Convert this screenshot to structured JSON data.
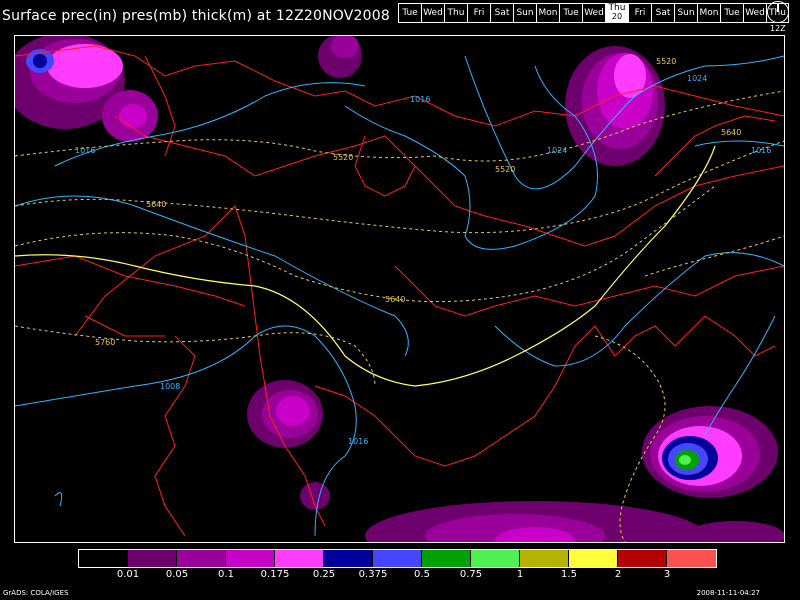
{
  "title": "Surface prec(in) pres(mb) thick(m) at 12Z20NOV2008",
  "days": [
    {
      "label": "Tue"
    },
    {
      "label": "Wed"
    },
    {
      "label": "Thu"
    },
    {
      "label": "Fri"
    },
    {
      "label": "Sat"
    },
    {
      "label": "Sun"
    },
    {
      "label": "Mon"
    },
    {
      "label": "Tue"
    },
    {
      "label": "Wed"
    },
    {
      "label": "Thu",
      "sub": "20",
      "active": true
    },
    {
      "label": "Fri"
    },
    {
      "label": "Sat"
    },
    {
      "label": "Sun"
    },
    {
      "label": "Mon"
    },
    {
      "label": "Tue"
    },
    {
      "label": "Wed"
    },
    {
      "label": "Thu"
    }
  ],
  "clock_label": "12Z",
  "clock_icon": "clock-icon",
  "legend": {
    "colors": [
      "#000000",
      "#6e006e",
      "#9a009a",
      "#c800c8",
      "#ff3cff",
      "#00009c",
      "#4646ff",
      "#00a000",
      "#50f050",
      "#b4b400",
      "#ffff3c",
      "#b40000",
      "#ff5050"
    ],
    "ticks": [
      "0.01",
      "0.05",
      "0.1",
      "0.175",
      "0.25",
      "0.375",
      "0.5",
      "0.75",
      "1",
      "1.5",
      "2",
      "3"
    ]
  },
  "contour_labels": {
    "pressure": [
      "1016",
      "1016",
      "1024",
      "1024",
      "1016",
      "1008",
      "1016"
    ],
    "thickness": [
      "5520",
      "5520",
      "5520",
      "5640",
      "5640",
      "5640",
      "5760"
    ]
  },
  "footer_left": "GrADS: COLA/IGES",
  "footer_right": "2008-11-11-04:27"
}
